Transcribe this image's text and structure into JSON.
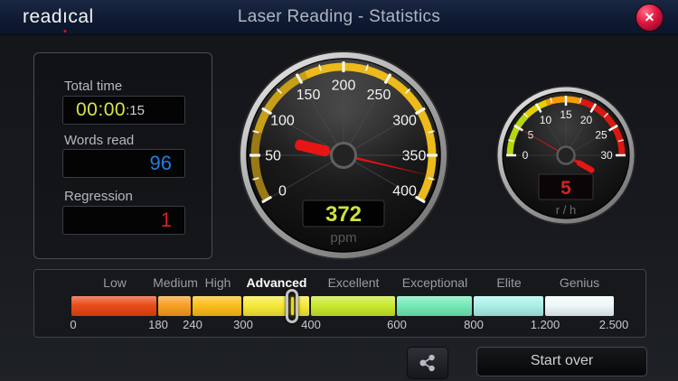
{
  "header": {
    "logo_pre": "read",
    "logo_i": "ı",
    "logo_post": "cal",
    "title": "Laser Reading - Statistics",
    "close_glyph": "✕"
  },
  "stats": {
    "total_time": {
      "label": "Total time",
      "main": "00:00",
      "seconds": ":15"
    },
    "words_read": {
      "label": "Words read",
      "value": "96"
    },
    "regression": {
      "label": "Regression",
      "value": "1"
    }
  },
  "big_gauge": {
    "name": "reading-speed-gauge",
    "min": 0,
    "max": 400,
    "value": "372",
    "unit": "ppm",
    "tick_labels": [
      "0",
      "50",
      "100",
      "150",
      "200",
      "250",
      "300",
      "350",
      "400"
    ]
  },
  "small_gauge": {
    "name": "regression-rate-gauge",
    "min": 0,
    "max": 30,
    "value": "5",
    "unit": "r / h",
    "tick_labels": [
      "0",
      "5",
      "10",
      "15",
      "20",
      "25",
      "30"
    ]
  },
  "scale": {
    "marker_value": 372,
    "tiers": [
      {
        "label": "Low",
        "from": 0,
        "to": 180,
        "color": "#e8430f"
      },
      {
        "label": "Medium",
        "from": 180,
        "to": 240,
        "color": "#f79c1b"
      },
      {
        "label": "High",
        "from": 240,
        "to": 300,
        "color": "#fbbb12"
      },
      {
        "label": "Advanced",
        "from": 300,
        "to": 400,
        "color": "#f6e832"
      },
      {
        "label": "Excellent",
        "from": 400,
        "to": 600,
        "color": "#c6e826"
      },
      {
        "label": "Exceptional",
        "from": 600,
        "to": 800,
        "color": "#6ee9b4"
      },
      {
        "label": "Elite",
        "from": 800,
        "to": 1200,
        "color": "#a7efe9"
      },
      {
        "label": "Genius",
        "from": 1200,
        "to": 2500,
        "color": "#eef8f8"
      }
    ],
    "ticks": [
      "0",
      "180",
      "240",
      "300",
      "400",
      "600",
      "800",
      "1.200",
      "2.500"
    ]
  },
  "footer": {
    "share_icon": "share-icon",
    "start_over": "Start over"
  },
  "colors": {
    "accent_yellow": "#cde23c",
    "value_blue": "#1f7fe0",
    "value_red": "#d92121",
    "needle_red": "#e01212",
    "band_gold": "#ecba1a",
    "topbar_navy": "#0f1b33"
  }
}
